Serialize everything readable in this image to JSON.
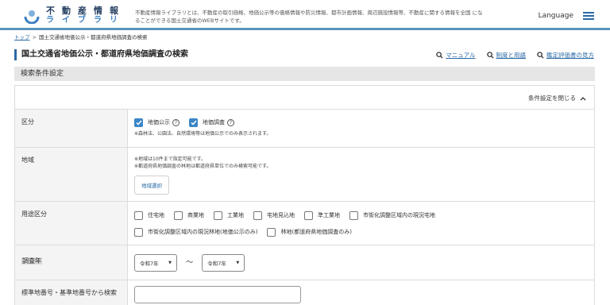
{
  "header": {
    "logo_top": "不動産情報",
    "logo_bottom": "ライブラリ",
    "description": "不動産情報ライブラリとは、不動産の取引価格、地価公示等の価格情報や防災情報、都市計画情報、周辺施設情報等、不動産に関する情報を全国 になることができる国土交通省のWEBサイトです。",
    "language": "Language",
    "menu_icon": "hamburger-menu-icon"
  },
  "breadcrumb": {
    "home": "トップ",
    "separator": ">",
    "current": "国土交通省地価公示・都道府県地価調査の検索"
  },
  "page": {
    "title": "国土交通省地価公示・都道府県地価調査の検索",
    "links": [
      "マニュアル",
      "制度と用語",
      "鑑定評価書の見方"
    ]
  },
  "section": {
    "heading": "検索条件設定",
    "close_label": "条件設定を閉じる"
  },
  "form": {
    "kubun": {
      "label": "区分",
      "options": [
        {
          "label": "地価公示",
          "checked": true
        },
        {
          "label": "地価調査",
          "checked": true
        }
      ],
      "note": "※森林法、公園法、自然環境等は地価公示でのみ表示されます。"
    },
    "area": {
      "label": "地域",
      "note1": "※地域は10件まで指定可能です。",
      "note2": "※都道府県地価調査の林地は都道府県単位でのみ検索可能です。",
      "button": "地域選択"
    },
    "usage": {
      "label": "用途区分",
      "options_row1": [
        "住宅地",
        "商業地",
        "工業地",
        "宅地見込地",
        "準工業地",
        "市街化調整区域内の現況宅地"
      ],
      "options_row2": [
        "市街化調整区域内の現況林地(地価公示のみ)",
        "林地(都道府県地価調査のみ)"
      ]
    },
    "year": {
      "label": "調査年",
      "from": "令和7年",
      "separator": "〜",
      "to": "令和7年"
    },
    "number": {
      "label": "標準地番号・基準地番号から検索",
      "placeholder": ""
    }
  },
  "colors": {
    "accent": "#2a6aa5",
    "checkbox": "#3a86c8",
    "header_border": "#5a93b8"
  }
}
